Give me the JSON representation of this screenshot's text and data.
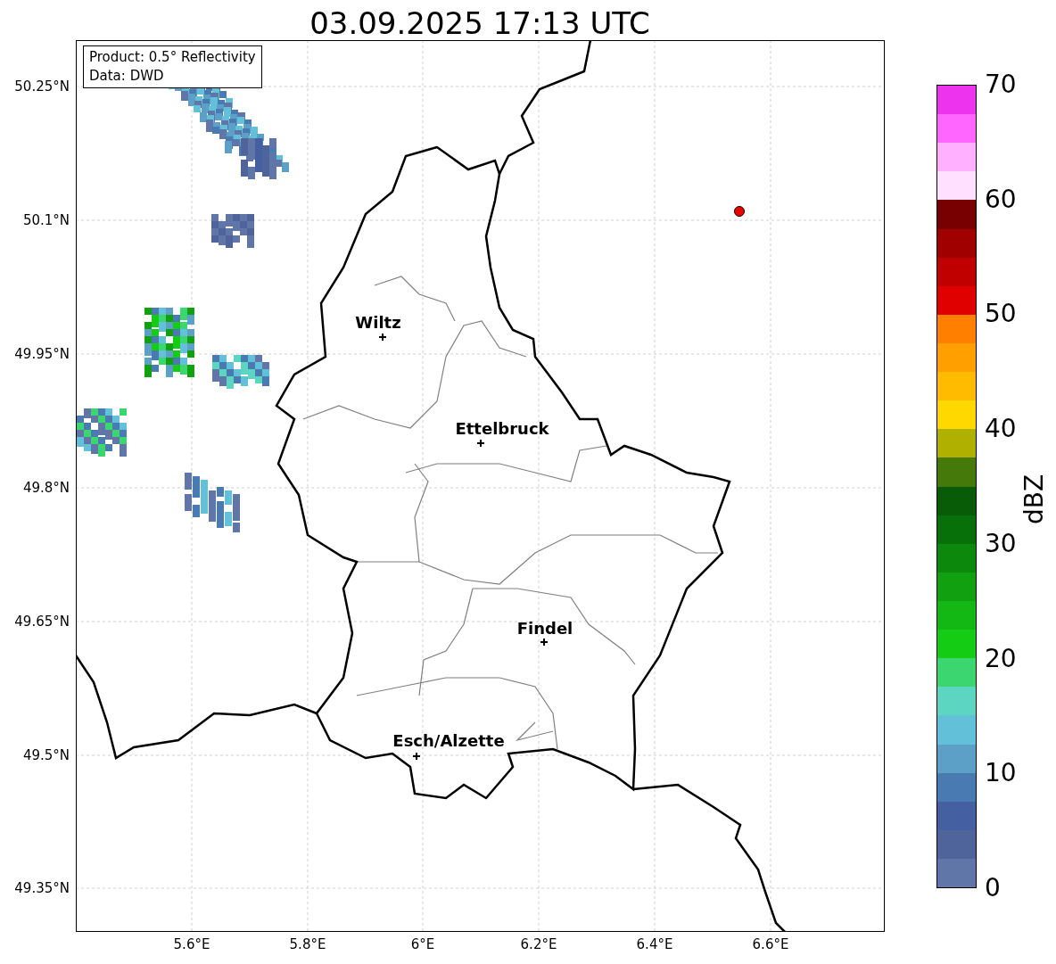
{
  "title": "03.09.2025 17:13 UTC",
  "info_box": [
    "Product: 0.5° Reflectivity",
    "Data: DWD"
  ],
  "y_ticks": [
    "50.25°N",
    "50.1°N",
    "49.95°N",
    "49.8°N",
    "49.65°N",
    "49.5°N",
    "49.35°N"
  ],
  "x_ticks": [
    "5.6°E",
    "5.8°E",
    "6°E",
    "6.2°E",
    "6.4°E",
    "6.6°E"
  ],
  "cities": [
    {
      "name": "Wiltz"
    },
    {
      "name": "Ettelbruck"
    },
    {
      "name": "Findel"
    },
    {
      "name": "Esch/Alzette"
    }
  ],
  "colorbar": {
    "label": "dBZ",
    "ticks": [
      "70",
      "60",
      "50",
      "40",
      "30",
      "20",
      "10",
      "0"
    ],
    "steps": [
      {
        "color": "#ee33ee"
      },
      {
        "color": "#ff66ff"
      },
      {
        "color": "#ffb0ff"
      },
      {
        "color": "#ffe0ff"
      },
      {
        "color": "#780000"
      },
      {
        "color": "#a00000"
      },
      {
        "color": "#c00000"
      },
      {
        "color": "#e00000"
      },
      {
        "color": "#ff8000"
      },
      {
        "color": "#ffa000"
      },
      {
        "color": "#ffbb00"
      },
      {
        "color": "#ffd800"
      },
      {
        "color": "#b0b000"
      },
      {
        "color": "#457a0a"
      },
      {
        "color": "#085c08"
      },
      {
        "color": "#087008"
      },
      {
        "color": "#0c880c"
      },
      {
        "color": "#10a010"
      },
      {
        "color": "#14b814"
      },
      {
        "color": "#14cc14"
      },
      {
        "color": "#3cd670"
      },
      {
        "color": "#5cd6c0"
      },
      {
        "color": "#62c0d8"
      },
      {
        "color": "#5ca0c8"
      },
      {
        "color": "#4a7ab2"
      },
      {
        "color": "#4460a0"
      },
      {
        "color": "#50649c"
      },
      {
        "color": "#6076a8"
      }
    ]
  }
}
